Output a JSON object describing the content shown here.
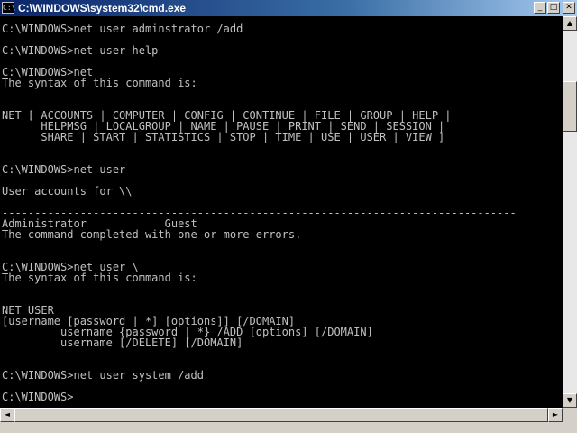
{
  "window": {
    "title": "C:\\WINDOWS\\system32\\cmd.exe",
    "icon_name": "cmd-icon",
    "icon_text": "C:\\"
  },
  "controls": {
    "minimize": "_",
    "maximize": "□",
    "close": "✕"
  },
  "console": {
    "lines": [
      "C:\\WINDOWS>net user adminstrator /add",
      "",
      "C:\\WINDOWS>net user help",
      "",
      "C:\\WINDOWS>net",
      "The syntax of this command is:",
      "",
      "",
      "NET [ ACCOUNTS | COMPUTER | CONFIG | CONTINUE | FILE | GROUP | HELP |",
      "      HELPMSG | LOCALGROUP | NAME | PAUSE | PRINT | SEND | SESSION |",
      "      SHARE | START | STATISTICS | STOP | TIME | USE | USER | VIEW ]",
      "",
      "",
      "C:\\WINDOWS>net user",
      "",
      "User accounts for \\\\",
      "",
      "-------------------------------------------------------------------------------",
      "Administrator            Guest",
      "The command completed with one or more errors.",
      "",
      "",
      "C:\\WINDOWS>net user \\",
      "The syntax of this command is:",
      "",
      "",
      "NET USER",
      "[username [password | *] [options]] [/DOMAIN]",
      "         username {password | *} /ADD [options] [/DOMAIN]",
      "         username [/DELETE] [/DOMAIN]",
      "",
      "",
      "C:\\WINDOWS>net user system /add",
      "",
      "C:\\WINDOWS>"
    ]
  },
  "scrollbars": {
    "up": "▲",
    "down": "▼",
    "left": "◄",
    "right": "►"
  }
}
